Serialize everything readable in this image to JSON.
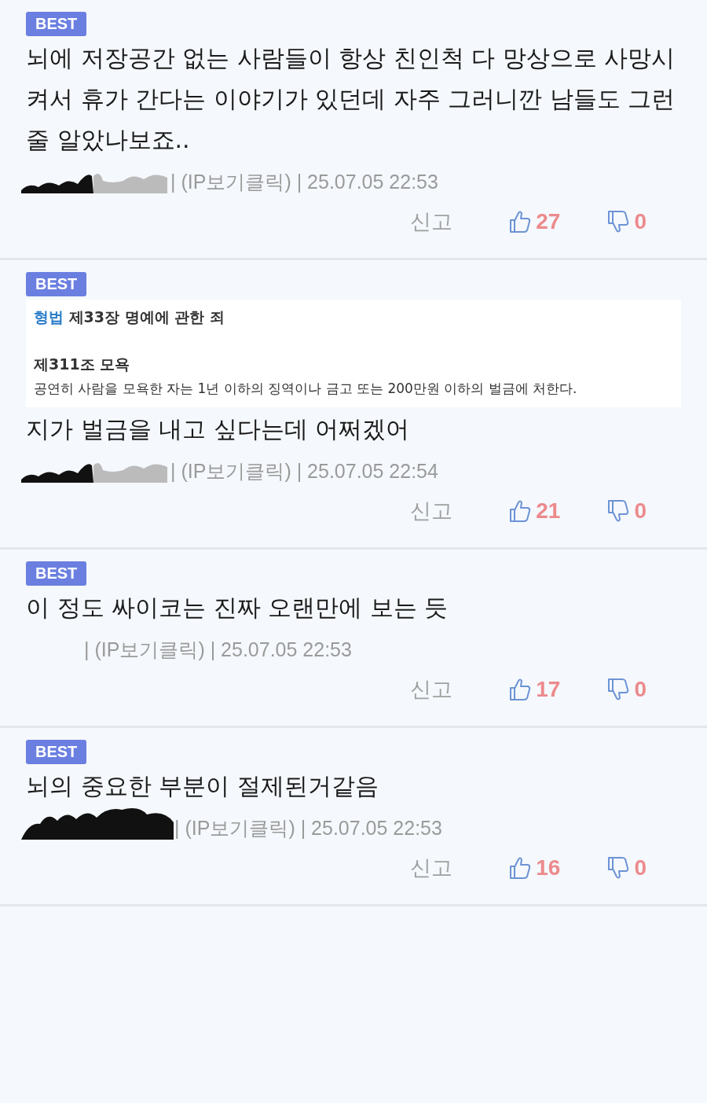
{
  "comments": [
    {
      "badge": "BEST",
      "body": "뇌에 저장공간 없는 사람들이 항상 친인척 다 망상으로 사망시켜서 휴가 간다는 이야기가 있던데 자주 그러니깐 남들도 그런 줄 알았나보죠..",
      "nickname": {
        "kind": "mixed"
      },
      "meta": "| (IP보기클릭) | 25.07.05 22:53",
      "report": "신고",
      "likes": "27",
      "dislikes": "0"
    },
    {
      "badge": "BEST",
      "quote": {
        "prefix": "형법",
        "title": "제33장 명예에 관한 죄",
        "heading": "제311조 모욕",
        "text": "공연히 사람을 모욕한 자는 1년 이하의 징역이나 금고 또는 200만원 이하의 벌금에 처한다."
      },
      "body": "지가 벌금을 내고 싶다는데 어쩌겠어",
      "nickname": {
        "kind": "mixed"
      },
      "meta": "| (IP보기클릭) | 25.07.05 22:54",
      "report": "신고",
      "likes": "21",
      "dislikes": "0"
    },
    {
      "badge": "BEST",
      "body": "이 정도 싸이코는 진짜 오랜만에 보는 듯",
      "nickname": {
        "kind": "blank"
      },
      "meta": "| (IP보기클릭) | 25.07.05 22:53",
      "report": "신고",
      "likes": "17",
      "dislikes": "0"
    },
    {
      "badge": "BEST",
      "body": "뇌의 중요한 부분이 절제된거같음",
      "nickname": {
        "kind": "dark"
      },
      "meta": "| (IP보기클릭) | 25.07.05 22:53",
      "report": "신고",
      "likes": "16",
      "dislikes": "0"
    }
  ]
}
